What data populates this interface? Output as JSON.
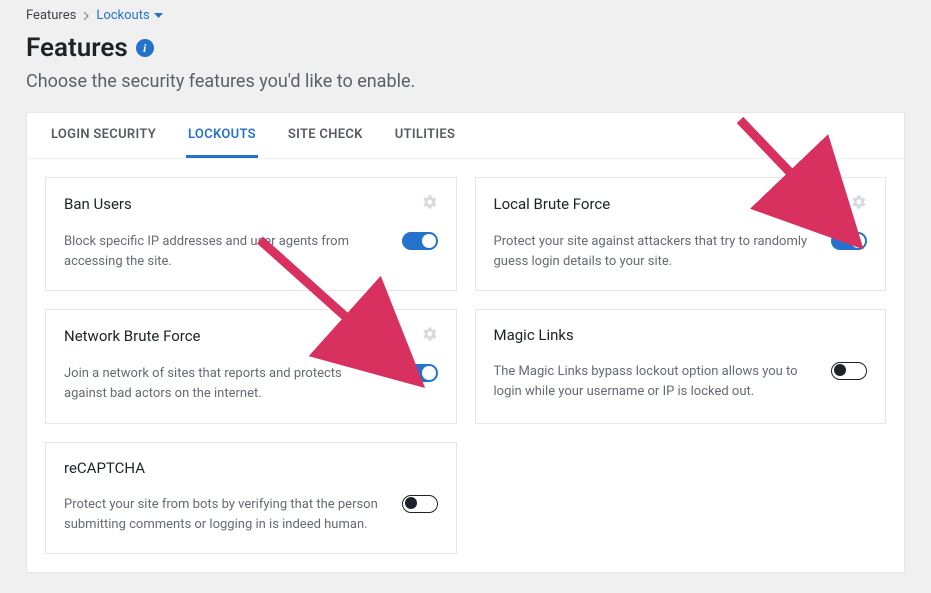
{
  "breadcrumb": {
    "root": "Features",
    "current": "Lockouts"
  },
  "page": {
    "title": "Features",
    "subtitle": "Choose the security features you'd like to enable."
  },
  "tabs": [
    {
      "label": "LOGIN SECURITY",
      "active": false
    },
    {
      "label": "LOCKOUTS",
      "active": true
    },
    {
      "label": "SITE CHECK",
      "active": false
    },
    {
      "label": "UTILITIES",
      "active": false
    }
  ],
  "cards": {
    "ban_users": {
      "title": "Ban Users",
      "desc": "Block specific IP addresses and user agents from accessing the site.",
      "enabled": true,
      "has_gear": true
    },
    "local_brute": {
      "title": "Local Brute Force",
      "desc": "Protect your site against attackers that try to randomly guess login details to your site.",
      "enabled": true,
      "has_gear": true
    },
    "network_brute": {
      "title": "Network Brute Force",
      "desc": "Join a network of sites that reports and protects against bad actors on the internet.",
      "enabled": true,
      "has_gear": true
    },
    "magic_links": {
      "title": "Magic Links",
      "desc": "The Magic Links bypass lockout option allows you to login while your username or IP is locked out.",
      "enabled": false,
      "has_gear": false
    },
    "recaptcha": {
      "title": "reCAPTCHA",
      "desc": "Protect your site from bots by verifying that the person submitting comments or logging in is indeed human.",
      "enabled": false,
      "has_gear": false
    }
  },
  "colors": {
    "accent": "#2572cc",
    "arrow": "#d8305f"
  }
}
